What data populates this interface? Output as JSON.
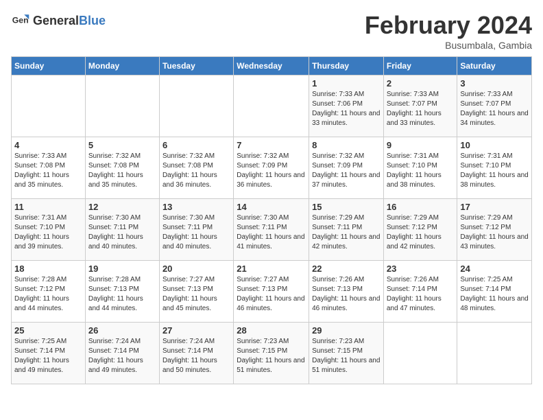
{
  "header": {
    "logo_general": "General",
    "logo_blue": "Blue",
    "month_title": "February 2024",
    "location": "Busumbala, Gambia"
  },
  "days_of_week": [
    "Sunday",
    "Monday",
    "Tuesday",
    "Wednesday",
    "Thursday",
    "Friday",
    "Saturday"
  ],
  "weeks": [
    [
      {
        "day": "",
        "info": ""
      },
      {
        "day": "",
        "info": ""
      },
      {
        "day": "",
        "info": ""
      },
      {
        "day": "",
        "info": ""
      },
      {
        "day": "1",
        "info": "Sunrise: 7:33 AM\nSunset: 7:06 PM\nDaylight: 11 hours\nand 33 minutes."
      },
      {
        "day": "2",
        "info": "Sunrise: 7:33 AM\nSunset: 7:07 PM\nDaylight: 11 hours\nand 33 minutes."
      },
      {
        "day": "3",
        "info": "Sunrise: 7:33 AM\nSunset: 7:07 PM\nDaylight: 11 hours\nand 34 minutes."
      }
    ],
    [
      {
        "day": "4",
        "info": "Sunrise: 7:33 AM\nSunset: 7:08 PM\nDaylight: 11 hours\nand 35 minutes."
      },
      {
        "day": "5",
        "info": "Sunrise: 7:32 AM\nSunset: 7:08 PM\nDaylight: 11 hours\nand 35 minutes."
      },
      {
        "day": "6",
        "info": "Sunrise: 7:32 AM\nSunset: 7:08 PM\nDaylight: 11 hours\nand 36 minutes."
      },
      {
        "day": "7",
        "info": "Sunrise: 7:32 AM\nSunset: 7:09 PM\nDaylight: 11 hours\nand 36 minutes."
      },
      {
        "day": "8",
        "info": "Sunrise: 7:32 AM\nSunset: 7:09 PM\nDaylight: 11 hours\nand 37 minutes."
      },
      {
        "day": "9",
        "info": "Sunrise: 7:31 AM\nSunset: 7:10 PM\nDaylight: 11 hours\nand 38 minutes."
      },
      {
        "day": "10",
        "info": "Sunrise: 7:31 AM\nSunset: 7:10 PM\nDaylight: 11 hours\nand 38 minutes."
      }
    ],
    [
      {
        "day": "11",
        "info": "Sunrise: 7:31 AM\nSunset: 7:10 PM\nDaylight: 11 hours\nand 39 minutes."
      },
      {
        "day": "12",
        "info": "Sunrise: 7:30 AM\nSunset: 7:11 PM\nDaylight: 11 hours\nand 40 minutes."
      },
      {
        "day": "13",
        "info": "Sunrise: 7:30 AM\nSunset: 7:11 PM\nDaylight: 11 hours\nand 40 minutes."
      },
      {
        "day": "14",
        "info": "Sunrise: 7:30 AM\nSunset: 7:11 PM\nDaylight: 11 hours\nand 41 minutes."
      },
      {
        "day": "15",
        "info": "Sunrise: 7:29 AM\nSunset: 7:11 PM\nDaylight: 11 hours\nand 42 minutes."
      },
      {
        "day": "16",
        "info": "Sunrise: 7:29 AM\nSunset: 7:12 PM\nDaylight: 11 hours\nand 42 minutes."
      },
      {
        "day": "17",
        "info": "Sunrise: 7:29 AM\nSunset: 7:12 PM\nDaylight: 11 hours\nand 43 minutes."
      }
    ],
    [
      {
        "day": "18",
        "info": "Sunrise: 7:28 AM\nSunset: 7:12 PM\nDaylight: 11 hours\nand 44 minutes."
      },
      {
        "day": "19",
        "info": "Sunrise: 7:28 AM\nSunset: 7:13 PM\nDaylight: 11 hours\nand 44 minutes."
      },
      {
        "day": "20",
        "info": "Sunrise: 7:27 AM\nSunset: 7:13 PM\nDaylight: 11 hours\nand 45 minutes."
      },
      {
        "day": "21",
        "info": "Sunrise: 7:27 AM\nSunset: 7:13 PM\nDaylight: 11 hours\nand 46 minutes."
      },
      {
        "day": "22",
        "info": "Sunrise: 7:26 AM\nSunset: 7:13 PM\nDaylight: 11 hours\nand 46 minutes."
      },
      {
        "day": "23",
        "info": "Sunrise: 7:26 AM\nSunset: 7:14 PM\nDaylight: 11 hours\nand 47 minutes."
      },
      {
        "day": "24",
        "info": "Sunrise: 7:25 AM\nSunset: 7:14 PM\nDaylight: 11 hours\nand 48 minutes."
      }
    ],
    [
      {
        "day": "25",
        "info": "Sunrise: 7:25 AM\nSunset: 7:14 PM\nDaylight: 11 hours\nand 49 minutes."
      },
      {
        "day": "26",
        "info": "Sunrise: 7:24 AM\nSunset: 7:14 PM\nDaylight: 11 hours\nand 49 minutes."
      },
      {
        "day": "27",
        "info": "Sunrise: 7:24 AM\nSunset: 7:14 PM\nDaylight: 11 hours\nand 50 minutes."
      },
      {
        "day": "28",
        "info": "Sunrise: 7:23 AM\nSunset: 7:15 PM\nDaylight: 11 hours\nand 51 minutes."
      },
      {
        "day": "29",
        "info": "Sunrise: 7:23 AM\nSunset: 7:15 PM\nDaylight: 11 hours\nand 51 minutes."
      },
      {
        "day": "",
        "info": ""
      },
      {
        "day": "",
        "info": ""
      }
    ]
  ]
}
